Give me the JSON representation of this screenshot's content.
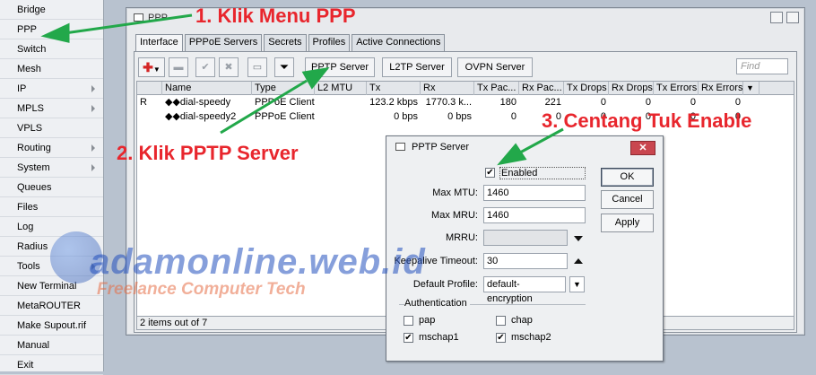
{
  "sidebar": {
    "items": [
      {
        "label": "Bridge",
        "submenu": false
      },
      {
        "label": "PPP",
        "submenu": false
      },
      {
        "label": "Switch",
        "submenu": false
      },
      {
        "label": "Mesh",
        "submenu": false
      },
      {
        "label": "IP",
        "submenu": true
      },
      {
        "label": "MPLS",
        "submenu": true
      },
      {
        "label": "VPLS",
        "submenu": false
      },
      {
        "label": "Routing",
        "submenu": true
      },
      {
        "label": "System",
        "submenu": true
      },
      {
        "label": "Queues",
        "submenu": false
      },
      {
        "label": "Files",
        "submenu": false
      },
      {
        "label": "Log",
        "submenu": false
      },
      {
        "label": "Radius",
        "submenu": false
      },
      {
        "label": "Tools",
        "submenu": true
      },
      {
        "label": "New Terminal",
        "submenu": false
      },
      {
        "label": "MetaROUTER",
        "submenu": false
      },
      {
        "label": "Make Supout.rif",
        "submenu": false
      },
      {
        "label": "Manual",
        "submenu": false
      },
      {
        "label": "Exit",
        "submenu": false
      }
    ]
  },
  "ppp_window": {
    "title": "PPP",
    "tabs": [
      "Interface",
      "PPPoE Servers",
      "Secrets",
      "Profiles",
      "Active Connections"
    ],
    "active_tab": "Interface",
    "toolbar": {
      "pptp_server": "PPTP Server",
      "l2tp_server": "L2TP Server",
      "ovpn_server": "OVPN Server",
      "find_placeholder": "Find"
    },
    "columns": [
      "Name",
      "Type",
      "L2 MTU",
      "Tx",
      "Rx",
      "Tx Pac...",
      "Rx Pac...",
      "Tx Drops",
      "Rx Drops",
      "Tx Errors",
      "Rx Errors"
    ],
    "rows": [
      {
        "flag": "R",
        "name": "◆◆dial-speedy",
        "type": "PPPoE Client",
        "l2mtu": "",
        "tx": "123.2 kbps",
        "rx": "1770.3 k...",
        "tx_pac": "180",
        "rx_pac": "221",
        "tx_drops": "0",
        "rx_drops": "0",
        "tx_errors": "0",
        "rx_errors": "0"
      },
      {
        "flag": "",
        "name": "◆◆dial-speedy2",
        "type": "PPPoE Client",
        "l2mtu": "",
        "tx": "0 bps",
        "rx": "0 bps",
        "tx_pac": "0",
        "rx_pac": "0",
        "tx_drops": "0",
        "rx_drops": "0",
        "tx_errors": "0",
        "rx_errors": "0"
      }
    ],
    "status": "2 items out of 7"
  },
  "dialog": {
    "title": "PPTP Server",
    "enabled_label": "Enabled",
    "enabled_checked": true,
    "max_mtu_label": "Max MTU:",
    "max_mtu": "1460",
    "max_mru_label": "Max MRU:",
    "max_mru": "1460",
    "mrru_label": "MRRU:",
    "mrru": "",
    "keepalive_label": "Keepalive Timeout:",
    "keepalive": "30",
    "profile_label": "Default Profile:",
    "profile": "default-encryption",
    "auth_label": "Authentication",
    "auth": [
      {
        "label": "pap",
        "checked": false
      },
      {
        "label": "chap",
        "checked": false
      },
      {
        "label": "mschap1",
        "checked": true
      },
      {
        "label": "mschap2",
        "checked": true
      }
    ],
    "ok": "OK",
    "cancel": "Cancel",
    "apply": "Apply"
  },
  "annotations": {
    "step1": "1. Klik Menu PPP",
    "step2": "2. Klik PPTP Server",
    "step3": "3. Centang Tuk Enable",
    "color": "#e8262d",
    "arrow_color": "#22a84a"
  },
  "watermark": {
    "main": "adamonline.web.id",
    "sub": "Freelance Computer Tech"
  }
}
